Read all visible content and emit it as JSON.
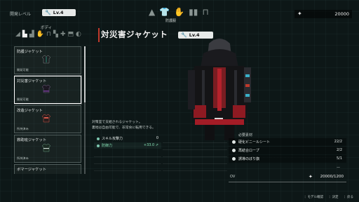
{
  "header": {
    "dev_level_label": "開発レベル",
    "dev_level_value": "Lv.4",
    "category_label": "防護服",
    "currency": "20000"
  },
  "body_tab": {
    "label": "ボディ"
  },
  "items": [
    {
      "name": "防護ジャケット",
      "status": "開発可能",
      "accent": "#2ea88a"
    },
    {
      "name": "対災害ジャケット",
      "status": "開発可能",
      "accent": "#6d3d8f"
    },
    {
      "name": "改造ジャケット",
      "status": "所持済み",
      "accent": "#d4584a"
    },
    {
      "name": "救助班ジャケット",
      "status": "所持済み",
      "accent": "#4a8a6a"
    },
    {
      "name": "ボマージャケット",
      "status": "",
      "accent": "#888888"
    }
  ],
  "selected": {
    "title": "対災害ジャケット",
    "level": "Lv.4",
    "description_line1": "対策室で支給されるジャケット。",
    "description_line2": "裏地は自由可能で、非常食に転用できる。"
  },
  "stats": [
    {
      "label": "スキル攻撃力",
      "value": "0"
    },
    {
      "label": "防御力",
      "value": "+33.0 ⇗"
    }
  ],
  "materials": {
    "header": "必要素材",
    "rows": [
      {
        "name": "硬化ビニールシート",
        "count": "22/2"
      },
      {
        "name": "再結合ロープ",
        "count": "2/2"
      },
      {
        "name": "誘導のぼり旗",
        "count": "5/1"
      }
    ],
    "placeholder": "—"
  },
  "cost": {
    "label": "OV",
    "value": "20000/1200"
  },
  "footer": {
    "hint1_key": "：",
    "hint1": "モデル確認",
    "hint2_key": "：",
    "hint2": "決定",
    "hint3_key": "：",
    "hint3": "戻る"
  },
  "colors": {
    "accent_red": "#c0392b",
    "stat_green": "#86e0b4"
  }
}
